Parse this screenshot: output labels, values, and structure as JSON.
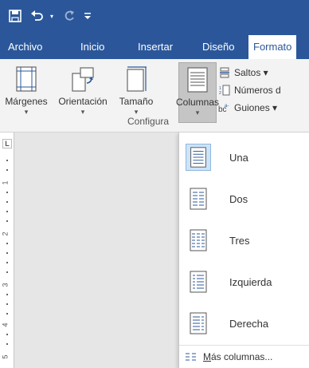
{
  "quick_access": {
    "save_icon": "save-icon",
    "undo_icon": "undo-icon",
    "redo_icon": "redo-icon",
    "customize_icon": "customize-qat-icon"
  },
  "tabs": [
    {
      "label": "Archivo"
    },
    {
      "label": "Inicio"
    },
    {
      "label": "Insertar"
    },
    {
      "label": "Diseño"
    },
    {
      "label": "Formato"
    }
  ],
  "ribbon": {
    "buttons": [
      {
        "label": "Márgenes",
        "icon": "margins-icon"
      },
      {
        "label": "Orientación",
        "icon": "orientation-icon"
      },
      {
        "label": "Tamaño",
        "icon": "size-icon"
      },
      {
        "label": "Columnas",
        "icon": "columns-icon"
      }
    ],
    "small_items": [
      {
        "label": "Saltos ▾",
        "icon": "breaks-icon"
      },
      {
        "label": "Números d",
        "icon": "line-numbers-icon"
      },
      {
        "label": "Guiones ▾",
        "icon": "hyphenation-icon"
      }
    ],
    "group_label": "Configura"
  },
  "ruler": {
    "tab_marker": "L",
    "numbers": [
      "1",
      "2",
      "3",
      "4",
      "5"
    ]
  },
  "columns_menu": {
    "items": [
      {
        "label": "Una",
        "icon": "one-column-icon"
      },
      {
        "label": "Dos",
        "icon": "two-columns-icon"
      },
      {
        "label": "Tres",
        "icon": "three-columns-icon"
      },
      {
        "label": "Izquierda",
        "icon": "left-column-icon"
      },
      {
        "label": "Derecha",
        "icon": "right-column-icon"
      }
    ],
    "more_label_accel": "M",
    "more_label_rest": "ás columnas..."
  },
  "colors": {
    "accent": "#2b579a",
    "ribbon": "#f3f3f3",
    "selected_menu": "#cde3f7"
  }
}
